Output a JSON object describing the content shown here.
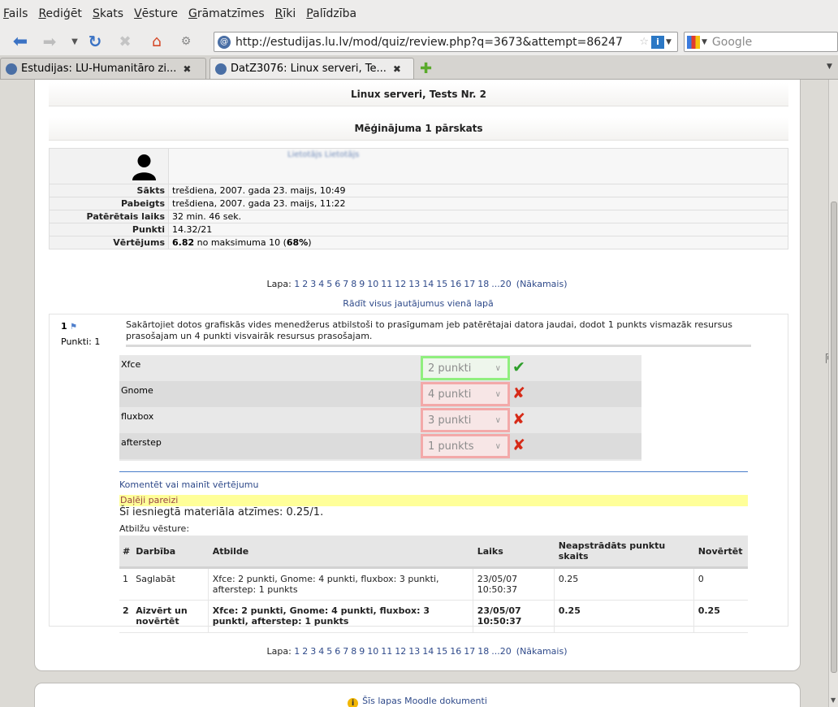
{
  "menu": [
    "Fails",
    "Rediģēt",
    "Skats",
    "Vēsture",
    "Grāmatzīmes",
    "Rīki",
    "Palīdzība"
  ],
  "menu_underline": [
    "F",
    "R",
    "S",
    "V",
    "G",
    "R",
    "P"
  ],
  "navbar": {
    "url": "http://estudijas.lu.lv/mod/quiz/review.php?q=3673&attempt=86247",
    "search_placeholder": "Google"
  },
  "tabs": [
    {
      "label": "Estudijas: LU-Humanitāro zi...",
      "active": false
    },
    {
      "label": "DatZ3076: Linux serveri, Te...",
      "active": true
    }
  ],
  "page": {
    "quiz_title": "Linux serveri, Tests Nr. 2",
    "review_title": "Mēģinājuma 1 pārskats",
    "summary": [
      {
        "label": "Sākts",
        "value": "trešdiena, 2007. gada 23. maijs, 10:49"
      },
      {
        "label": "Pabeigts",
        "value": "trešdiena, 2007. gada 23. maijs, 11:22"
      },
      {
        "label": "Patērētais laiks",
        "value": "32 min. 46 sek."
      },
      {
        "label": "Punkti",
        "value": "14.32/21"
      }
    ],
    "grade_row": {
      "label": "Vērtējums",
      "score": "6.82",
      "middle": "no maksimuma 10 (",
      "percent": "68%",
      "end": ")"
    },
    "user_name": "Lietotājs Lietotājs",
    "paging": {
      "label": "Lapa:",
      "pages": [
        "1",
        "2",
        "3",
        "4",
        "5",
        "6",
        "7",
        "8",
        "9",
        "10",
        "11",
        "12",
        "13",
        "14",
        "15",
        "16",
        "17",
        "18",
        "...20"
      ],
      "next": "(Nākamais)"
    },
    "show_all": "Rādīt visus jautājumus vienā lapā",
    "question": {
      "number": "1",
      "points_label": "Punkti: 1",
      "text": "Sakārtojiet dotos grafiskās vides menedžerus atbilstoši to prasīgumam jeb patērētajai datora jaudai, dodot 1 punkts vismazāk resursus prasošajam un 4 punkti visvairāk resursus prasošajam.",
      "items": [
        {
          "label": "Xfce",
          "answer": "2 punkti",
          "correct": true
        },
        {
          "label": "Gnome",
          "answer": "4 punkti",
          "correct": false
        },
        {
          "label": "fluxbox",
          "answer": "3 punkti",
          "correct": false
        },
        {
          "label": "afterstep",
          "answer": "1 punkts",
          "correct": false
        }
      ],
      "comment_link": "Komentēt vai mainīt vērtējumu",
      "partial": "Daļēji pareizi",
      "grade": "Šī iesniegtā materiāla atzīmes: 0.25/1.",
      "history_label": "Atbilžu vēsture:",
      "history_headers": [
        "#",
        "Darbība",
        "Atbilde",
        "Laiks",
        "Neapstrādāts punktu skaits",
        "Novērtēt"
      ],
      "history_rows": [
        {
          "n": "1",
          "action": "Saglabāt",
          "answer": "Xfce: 2 punkti, Gnome: 4 punkti, fluxbox: 3 punkti, afterstep: 1 punkts",
          "time": "23/05/07 10:50:37",
          "raw": "0.25",
          "grade": "0",
          "bold": false
        },
        {
          "n": "2",
          "action": "Aizvērt un novērtēt",
          "answer": "Xfce: 2 punkti, Gnome: 4 punkti, fluxbox: 3 punkti, afterstep: 1 punkts",
          "time": "23/05/07 10:50:37",
          "raw": "0.25",
          "grade": "0.25",
          "bold": true
        }
      ]
    },
    "footer_link": "Šīs lapas Moodle dokumenti"
  },
  "colors": {
    "link": "#2f4a8a",
    "correct": "#2e9e2b",
    "incorrect": "#d62a17",
    "highlight": "#ffff99"
  }
}
